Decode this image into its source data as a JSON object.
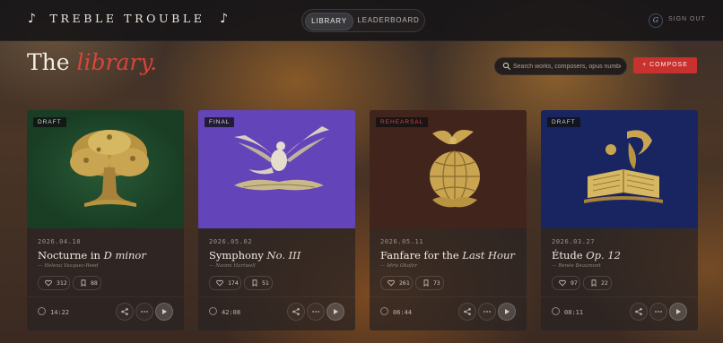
{
  "app": {
    "brand_left": "♪",
    "brand_name": "TREBLE TROUBLE",
    "brand_right": "♪"
  },
  "nav": {
    "tabs": [
      {
        "label": "LIBRARY",
        "active": true
      },
      {
        "label": "LEADERBOARD",
        "active": false
      }
    ]
  },
  "user": {
    "initial": "G",
    "signout_label": "SIGN OUT"
  },
  "page": {
    "title_plain": "The",
    "title_accent": "library."
  },
  "search": {
    "placeholder": "Search works, composers, opus numbers"
  },
  "compose": {
    "label": "+ COMPOSE"
  },
  "colors": {
    "accent": "#c8312d",
    "title_accent": "#d8453a"
  },
  "cards": [
    {
      "status": "DRAFT",
      "date": "2026.04.18",
      "title_plain": "Nocturne in ",
      "title_italic": "D minor",
      "author": "— Helena Vasquez-Reed",
      "likes": "312",
      "saves": "88",
      "duration": "14:22",
      "cover_color": "#1f4a2c",
      "cover_art": "tree-emblem"
    },
    {
      "status": "FINAL",
      "date": "2026.05.02",
      "title_plain": "Symphony ",
      "title_italic": "No. III",
      "author": "— Naomi Hartwell",
      "likes": "174",
      "saves": "51",
      "duration": "42:08",
      "cover_color": "#6b4bc2",
      "cover_art": "winged-figure-emblem"
    },
    {
      "status": "REHEARSAL",
      "date": "2026.05.11",
      "title_plain": "Fanfare for the ",
      "title_italic": "Last Hour",
      "author": "— Idris Okafor",
      "likes": "261",
      "saves": "73",
      "duration": "06:44",
      "cover_color": "#4a2a20",
      "cover_art": "eagle-globe-emblem"
    },
    {
      "status": "DRAFT",
      "date": "2026.03.27",
      "title_plain": "Étude ",
      "title_italic": "Op. 12",
      "author": "— Renée Beaumont",
      "likes": "97",
      "saves": "22",
      "duration": "08:11",
      "cover_color": "#1e2a6a",
      "cover_art": "open-book-emblem"
    }
  ]
}
